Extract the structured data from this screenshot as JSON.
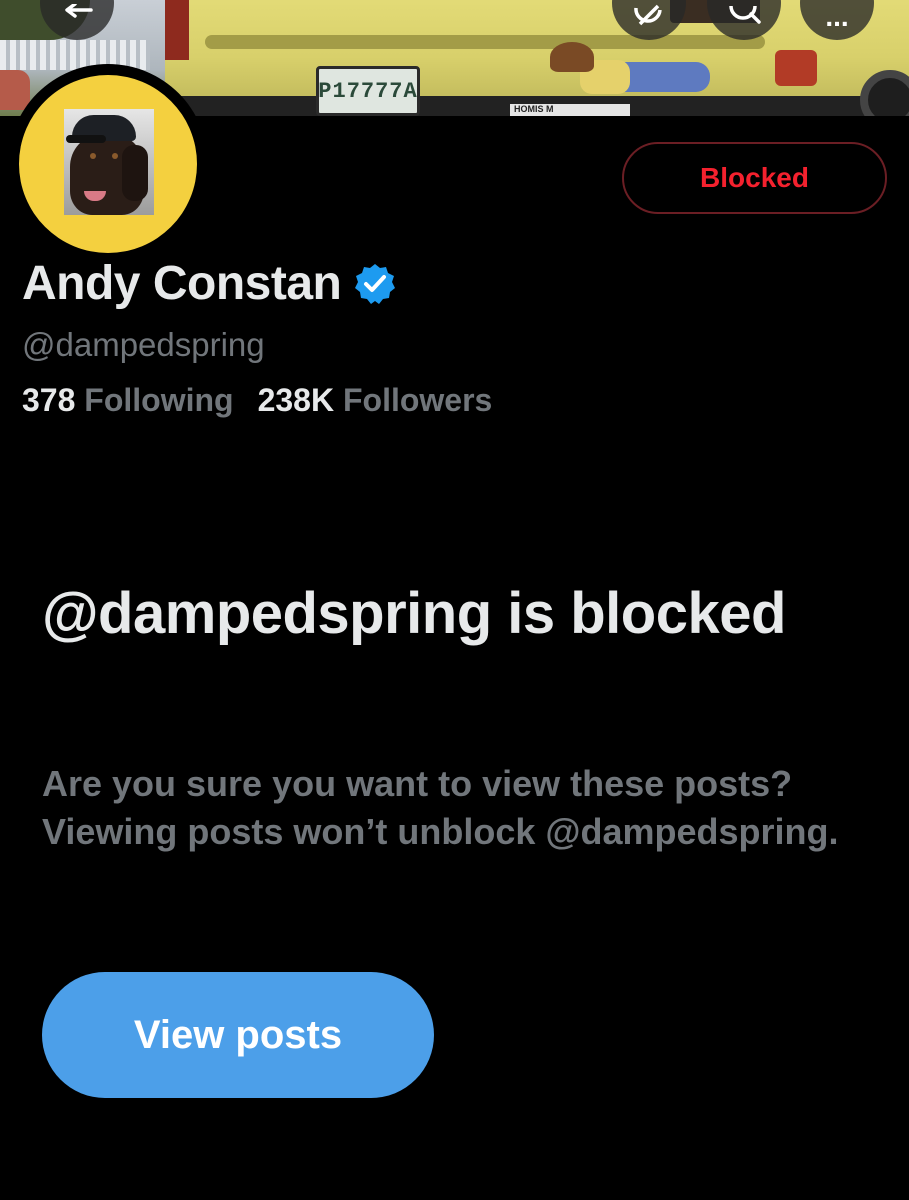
{
  "banner": {
    "plate_text": "P17777A",
    "bumper_sticker_text": "HOMIS M"
  },
  "header_buttons": {
    "back_icon": "arrow-left-icon",
    "grok_icon": "grok-icon",
    "search_icon": "search-icon",
    "more_icon": "more-horizontal-icon",
    "more_label": "..."
  },
  "profile": {
    "name": "Andy Constan",
    "verified": true,
    "handle": "@dampedspring",
    "following_count": "378",
    "following_label": "Following",
    "followers_count": "238K",
    "followers_label": "Followers"
  },
  "actions": {
    "blocked_label": "Blocked"
  },
  "blocked_notice": {
    "title": "@dampedspring is blocked",
    "description": "Are you sure you want to view these posts? Viewing posts won’t unblock @dampedspring.",
    "view_posts_label": "View posts"
  },
  "colors": {
    "background": "#000000",
    "primary_text": "#e7e9ea",
    "secondary_text": "#71767b",
    "blocked_red": "#f4212e",
    "view_button_blue": "#4c9fe9",
    "avatar_bg": "#f4d03f",
    "verified_blue": "#1d9bf0"
  }
}
